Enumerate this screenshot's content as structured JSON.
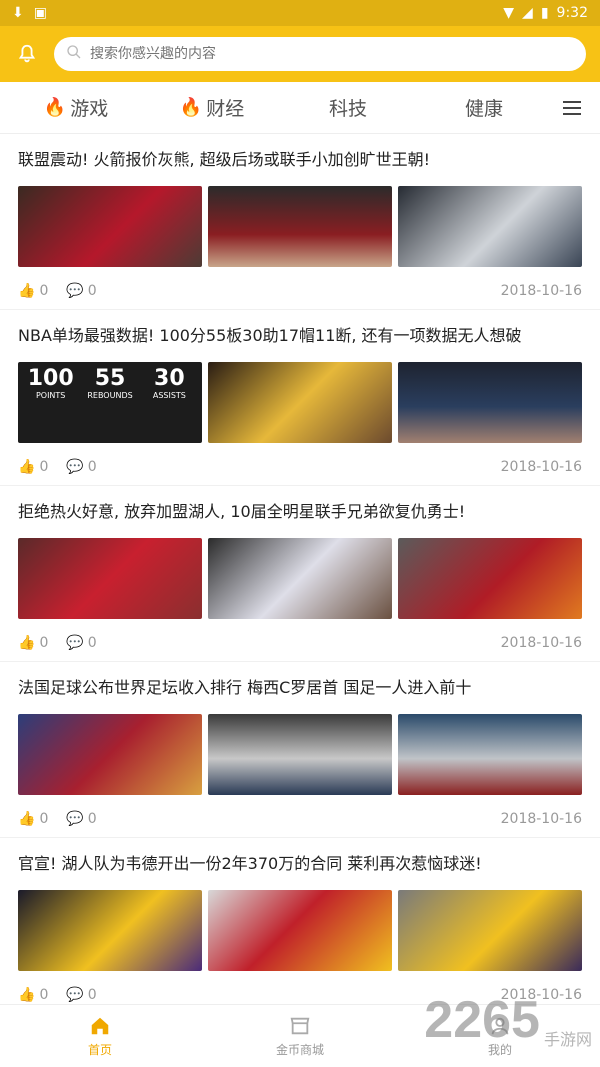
{
  "status_bar": {
    "time": "9:32"
  },
  "search": {
    "placeholder": "搜索你感兴趣的内容"
  },
  "tabs": [
    {
      "label": "游戏",
      "hot": true
    },
    {
      "label": "财经",
      "hot": true
    },
    {
      "label": "科技",
      "hot": false
    },
    {
      "label": "健康",
      "hot": false
    }
  ],
  "articles": [
    {
      "title": "联盟震动! 火箭报价灰熊, 超级后场或联手小加创旷世王朝!",
      "likes": "0",
      "comments": "0",
      "date": "2018-10-16",
      "images": [
        "rockets-players",
        "rockets-press",
        "grizzlies-33"
      ]
    },
    {
      "title": "NBA单场最强数据! 100分55板30助17帽11断, 还有一项数据无人想破",
      "likes": "0",
      "comments": "0",
      "date": "2018-10-16",
      "images": [
        "stats-graphic",
        "lakers-shot",
        "wolves-42"
      ],
      "stat_graphic": [
        {
          "num": "100",
          "label": "POINTS"
        },
        {
          "num": "55",
          "label": "REBOUNDS"
        },
        {
          "num": "30",
          "label": "ASSISTS"
        }
      ]
    },
    {
      "title": "拒绝热火好意, 放弃加盟湖人, 10届全明星联手兄弟欲复仇勇士!",
      "likes": "0",
      "comments": "0",
      "date": "2018-10-16",
      "images": [
        "rockets-7",
        "sixers-25",
        "houston-3"
      ]
    },
    {
      "title": "法国足球公布世界足坛收入排行 梅西C罗居首 国足一人进入前十",
      "likes": "0",
      "comments": "0",
      "date": "2018-10-16",
      "images": [
        "messi-10",
        "coach-white-hair",
        "coach-cap"
      ]
    },
    {
      "title": "官宣! 湖人队为韦德开出一份2年370万的合同 莱利再次惹恼球迷!",
      "likes": "0",
      "comments": "0",
      "date": "2018-10-16",
      "images": [
        "lakers-player",
        "heat-wade",
        "lakers-back"
      ]
    }
  ],
  "bottom_nav": [
    {
      "label": "首页",
      "icon": "home-icon",
      "active": true
    },
    {
      "label": "金币商城",
      "icon": "shop-icon",
      "active": false
    },
    {
      "label": "我的",
      "icon": "profile-icon",
      "active": false
    }
  ],
  "watermark": {
    "text": "2265",
    "sub": "手游网"
  },
  "colors": {
    "accent": "#f7c215",
    "accent_dark": "#e0b012",
    "flame": "#e63a2b",
    "active_nav": "#f0a800"
  }
}
